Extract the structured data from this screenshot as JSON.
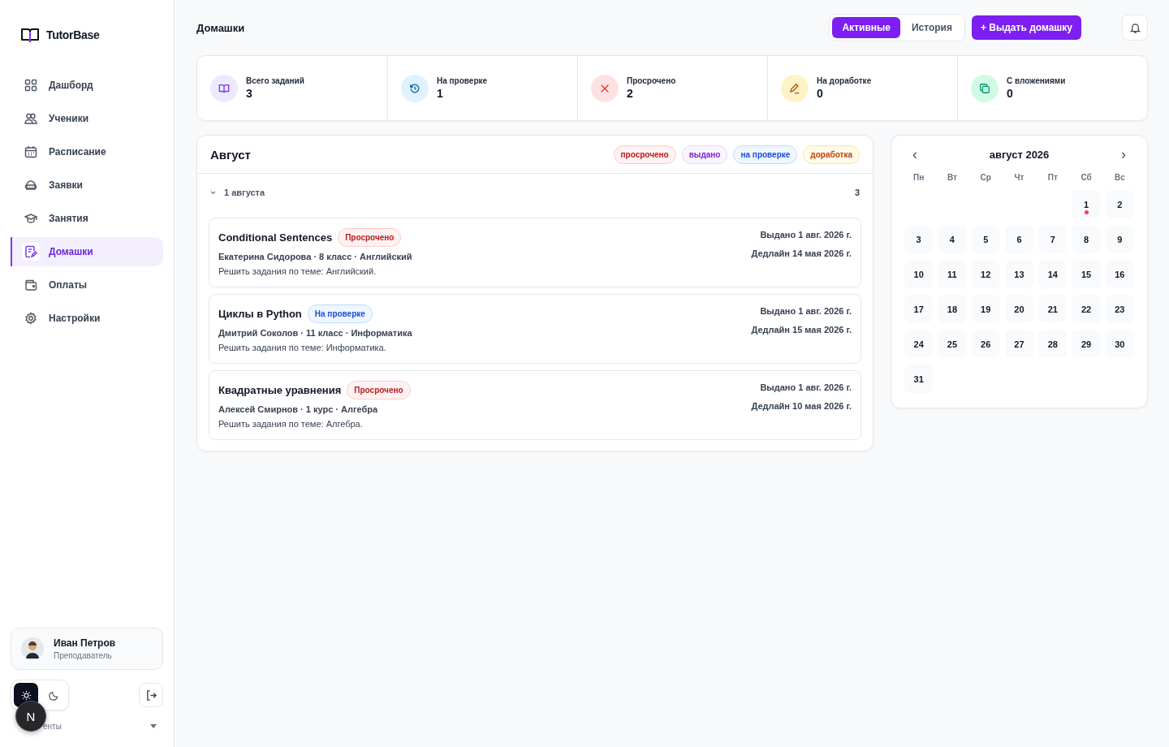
{
  "brand": {
    "name": "TutorBase"
  },
  "nav": [
    {
      "kind": "dashboard",
      "label": "Дашборд",
      "selected": false
    },
    {
      "kind": "students",
      "label": "Ученики",
      "selected": false
    },
    {
      "kind": "schedule",
      "label": "Расписание",
      "selected": false
    },
    {
      "kind": "requests",
      "label": "Заявки",
      "selected": false
    },
    {
      "kind": "lessons",
      "label": "Занятия",
      "selected": false
    },
    {
      "kind": "homework",
      "label": "Домашки",
      "selected": true
    },
    {
      "kind": "payments",
      "label": "Оплаты",
      "selected": false
    },
    {
      "kind": "settings",
      "label": "Настройки",
      "selected": false
    }
  ],
  "user": {
    "name": "Иван Петров",
    "role": "Преподаватель"
  },
  "theme_toggle": [
    {
      "kind": "light",
      "selected": true
    },
    {
      "kind": "dark",
      "selected": false
    }
  ],
  "footer_select": {
    "value": "енты"
  },
  "dev_badge": {
    "label": "N"
  },
  "header": {
    "title": "Домашки",
    "tabs": [
      {
        "label": "Активные",
        "selected": true
      },
      {
        "label": "История",
        "selected": false
      }
    ],
    "primary_button": "+ Выдать домашку"
  },
  "stats": [
    {
      "kind": "book",
      "label": "Всего заданий",
      "value": "3"
    },
    {
      "kind": "history",
      "label": "На проверке",
      "value": "1"
    },
    {
      "kind": "cross",
      "label": "Просрочено",
      "value": "2"
    },
    {
      "kind": "pencil",
      "label": "На доработке",
      "value": "0"
    },
    {
      "kind": "copy",
      "label": "С вложениями",
      "value": "0"
    }
  ],
  "month_panel": {
    "title": "Август",
    "legend": [
      {
        "kind": "overdue",
        "label": "просрочено"
      },
      {
        "kind": "issued",
        "label": "выдано"
      },
      {
        "kind": "review",
        "label": "на проверке"
      },
      {
        "kind": "rework",
        "label": "доработка"
      }
    ],
    "groups": [
      {
        "date": "1 августа",
        "count": "3",
        "expanded": true,
        "items": [
          {
            "title": "Conditional Sentences",
            "status": {
              "kind": "overdue",
              "label": "Просрочено"
            },
            "meta": "Екатерина Сидорова · 8 класс · Английский",
            "description": "Решить задания по теме: Английский.",
            "issued": "Выдано 1 авг. 2026 г.",
            "deadline": "Дедлайн 14 мая 2026 г."
          },
          {
            "title": "Циклы в Python",
            "status": {
              "kind": "review",
              "label": "На проверке"
            },
            "meta": "Дмитрий Соколов · 11 класс · Информатика",
            "description": "Решить задания по теме: Информатика.",
            "issued": "Выдано 1 авг. 2026 г.",
            "deadline": "Дедлайн 15 мая 2026 г."
          },
          {
            "title": "Квадратные уравнения",
            "status": {
              "kind": "overdue",
              "label": "Просрочено"
            },
            "meta": "Алексей Смирнов · 1 курс · Алгебра",
            "description": "Решить задания по теме: Алгебра.",
            "issued": "Выдано 1 авг. 2026 г.",
            "deadline": "Дедлайн 10 мая 2026 г."
          }
        ]
      }
    ]
  },
  "calendar": {
    "title": "август 2026",
    "prev": "‹",
    "next": "›",
    "weekdays": [
      "Пн",
      "Вт",
      "Ср",
      "Чт",
      "Пт",
      "Сб",
      "Вс"
    ],
    "weeks": [
      [
        {
          "kind": "blank"
        },
        {
          "kind": "blank"
        },
        {
          "kind": "blank"
        },
        {
          "kind": "blank"
        },
        {
          "kind": "blank"
        },
        {
          "day": "1",
          "has_tasks": true
        },
        {
          "day": "2",
          "has_tasks": false
        }
      ],
      [
        {
          "day": "3",
          "has_tasks": false
        },
        {
          "day": "4",
          "has_tasks": false
        },
        {
          "day": "5",
          "has_tasks": false
        },
        {
          "day": "6",
          "has_tasks": false
        },
        {
          "day": "7",
          "has_tasks": false
        },
        {
          "day": "8",
          "has_tasks": false
        },
        {
          "day": "9",
          "has_tasks": false
        }
      ],
      [
        {
          "day": "10",
          "has_tasks": false
        },
        {
          "day": "11",
          "has_tasks": false
        },
        {
          "day": "12",
          "has_tasks": false
        },
        {
          "day": "13",
          "has_tasks": false
        },
        {
          "day": "14",
          "has_tasks": false
        },
        {
          "day": "15",
          "has_tasks": false
        },
        {
          "day": "16",
          "has_tasks": false
        }
      ],
      [
        {
          "day": "17",
          "has_tasks": false
        },
        {
          "day": "18",
          "has_tasks": false
        },
        {
          "day": "19",
          "has_tasks": false
        },
        {
          "day": "20",
          "has_tasks": false
        },
        {
          "day": "21",
          "has_tasks": false
        },
        {
          "day": "22",
          "has_tasks": false
        },
        {
          "day": "23",
          "has_tasks": false
        }
      ],
      [
        {
          "day": "24",
          "has_tasks": false
        },
        {
          "day": "25",
          "has_tasks": false
        },
        {
          "day": "26",
          "has_tasks": false
        },
        {
          "day": "27",
          "has_tasks": false
        },
        {
          "day": "28",
          "has_tasks": false
        },
        {
          "day": "29",
          "has_tasks": false
        },
        {
          "day": "30",
          "has_tasks": false
        }
      ],
      [
        {
          "day": "31",
          "has_tasks": false
        },
        {
          "kind": "blank"
        },
        {
          "kind": "blank"
        },
        {
          "kind": "blank"
        },
        {
          "kind": "blank"
        },
        {
          "kind": "blank"
        },
        {
          "kind": "blank"
        }
      ]
    ]
  }
}
